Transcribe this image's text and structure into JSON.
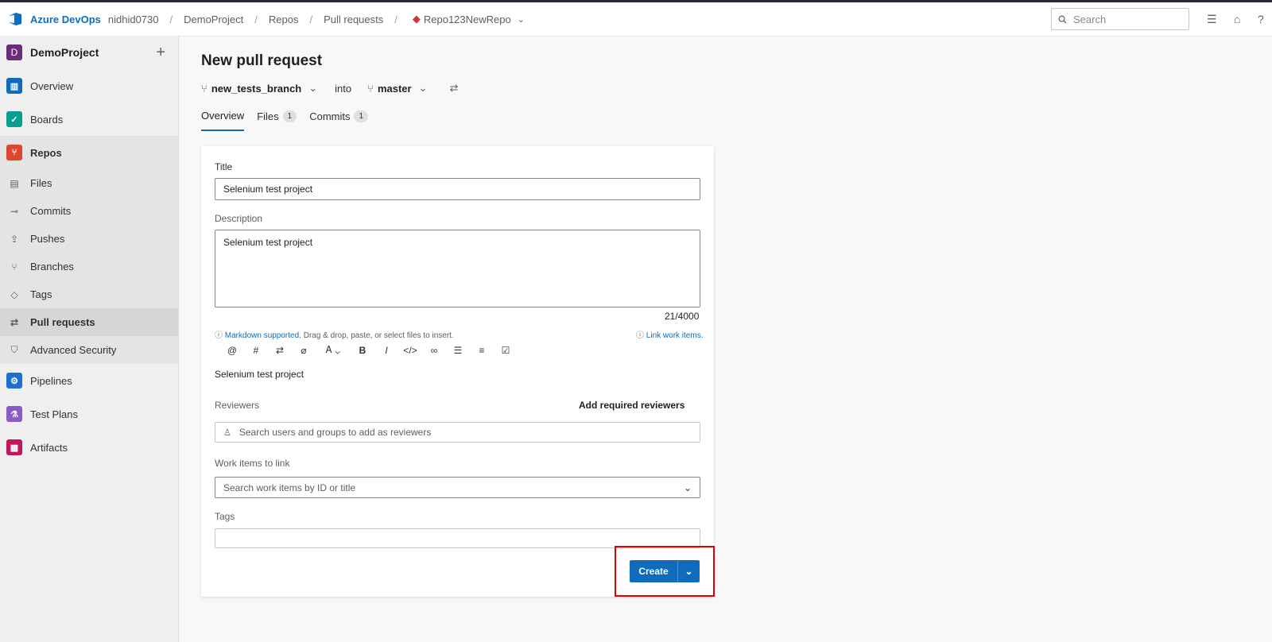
{
  "topbar": {
    "brand": "Azure DevOps",
    "breadcrumb": [
      "nidhid0730",
      "DemoProject",
      "Repos",
      "Pull requests",
      "Repo123NewRepo"
    ],
    "search_placeholder": "Search"
  },
  "sidebar": {
    "project_initial": "D",
    "project_name": "DemoProject",
    "items": [
      {
        "label": "Overview"
      },
      {
        "label": "Boards"
      },
      {
        "label": "Repos"
      },
      {
        "label": "Files"
      },
      {
        "label": "Commits"
      },
      {
        "label": "Pushes"
      },
      {
        "label": "Branches"
      },
      {
        "label": "Tags"
      },
      {
        "label": "Pull requests"
      },
      {
        "label": "Advanced Security"
      },
      {
        "label": "Pipelines"
      },
      {
        "label": "Test Plans"
      },
      {
        "label": "Artifacts"
      }
    ]
  },
  "main": {
    "title": "New pull request",
    "source_branch": "new_tests_branch",
    "into": "into",
    "target_branch": "master",
    "tabs": [
      {
        "label": "Overview"
      },
      {
        "label": "Files",
        "count": "1"
      },
      {
        "label": "Commits",
        "count": "1"
      }
    ]
  },
  "form": {
    "title_label": "Title",
    "title_value": "Selenium test project",
    "description_label": "Description",
    "description_value": "Selenium test project",
    "char_count": "21/4000",
    "markdown_link": "Markdown supported.",
    "markdown_hint": " Drag & drop, paste, or select files to insert.",
    "link_work_items": "Link work items.",
    "preview_text": "Selenium test project",
    "reviewers_label": "Reviewers",
    "add_required_reviewers": "Add required reviewers",
    "reviewers_placeholder": "Search users and groups to add as reviewers",
    "work_items_label": "Work items to link",
    "work_items_placeholder": "Search work items by ID or title",
    "tags_label": "Tags",
    "create_label": "Create"
  },
  "colors": {
    "accent": "#0f6cbd",
    "highlight_box": "#e00000"
  }
}
